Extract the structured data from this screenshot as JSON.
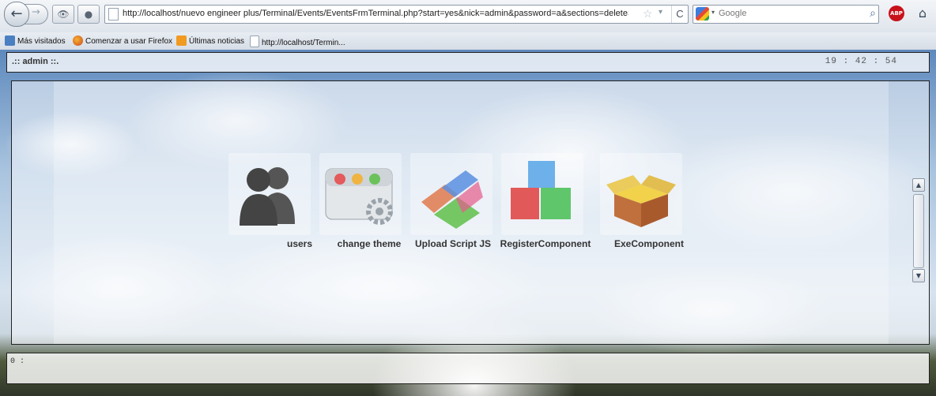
{
  "browser": {
    "url": "http://localhost/nuevo engineer plus/Terminal/Events/EventsFrmTerminal.php?start=yes&nick=admin&password=a&sections=deleteScriptJS_unRegiste",
    "search_engine": "Google",
    "abp_label": "ABP"
  },
  "bookmarks": [
    {
      "label": "Más visitados",
      "icon": "magnifier-icon"
    },
    {
      "label": "Comenzar a usar Firefox",
      "icon": "firefox-icon"
    },
    {
      "label": "Últimas noticias",
      "icon": "rss-icon"
    },
    {
      "label": "http://localhost/Termin...",
      "icon": "page-icon"
    }
  ],
  "header": {
    "user": ".:: admin ::.",
    "clock": "19 : 42 : 54"
  },
  "desktop": {
    "icons": [
      {
        "label": "users",
        "icon": "users-icon"
      },
      {
        "label": "change theme",
        "icon": "theme-window-icon"
      },
      {
        "label": "Upload Script JS",
        "icon": "puzzle-blocks-icon"
      },
      {
        "label": "RegisterComponent",
        "icon": "stacked-cubes-icon"
      },
      {
        "label": "ExeComponent",
        "icon": "open-box-icon"
      }
    ]
  },
  "console": {
    "prompt": "0 :"
  },
  "colors": {
    "frame_border": "#222222",
    "abp_red": "#c8111a"
  }
}
